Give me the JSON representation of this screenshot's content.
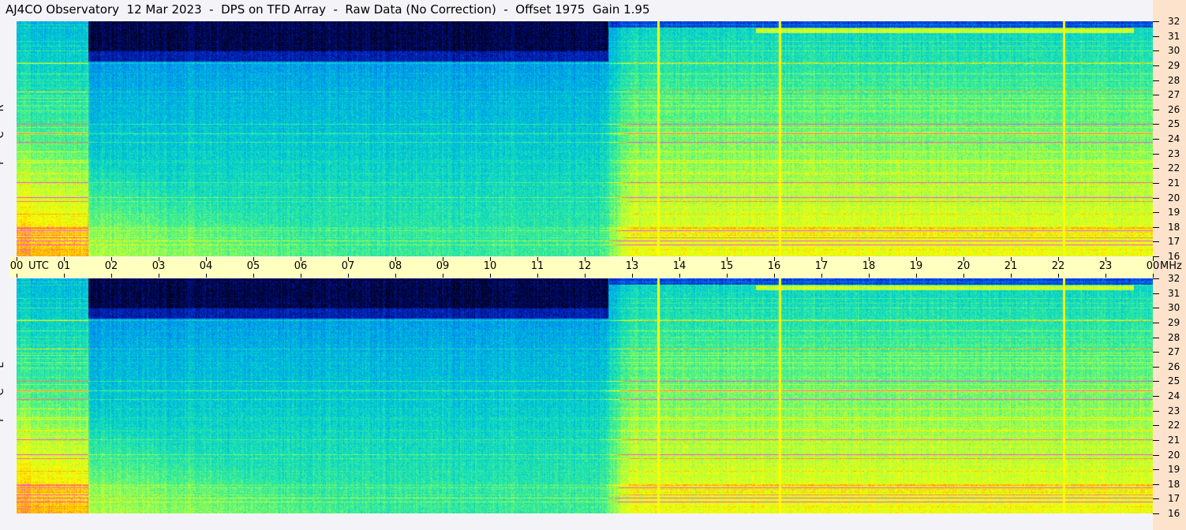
{
  "title": "AJ4CO Observatory  12 Mar 2023  -  DPS on TFD Array  -  Raw Data (No Correction)  -  Offset 1975  Gain 1.95",
  "chart_data": [
    {
      "type": "heatmap",
      "panel": "top",
      "ylabel": "R C P",
      "xlabel": "UTC",
      "yunit": "MHz",
      "xlim_hours_utc": [
        0,
        24
      ],
      "ylim_mhz": [
        16,
        32
      ],
      "x_ticks": [
        "00",
        "01",
        "02",
        "03",
        "04",
        "05",
        "06",
        "07",
        "08",
        "09",
        "10",
        "11",
        "12",
        "13",
        "14",
        "15",
        "16",
        "17",
        "18",
        "19",
        "20",
        "21",
        "22",
        "23",
        "00"
      ],
      "y_ticks": [
        "16",
        "17",
        "18",
        "19",
        "20",
        "21",
        "22",
        "23",
        "24",
        "25",
        "26",
        "27",
        "28",
        "29",
        "30",
        "31",
        "32"
      ],
      "colormap": [
        "#000010",
        "#001090",
        "#0040e0",
        "#0090f0",
        "#00d0d0",
        "#40f090",
        "#b0ff40",
        "#ffff00",
        "#ffa000",
        "#ff40ff"
      ]
    },
    {
      "type": "heatmap",
      "panel": "bottom",
      "ylabel": "L C P",
      "xlabel": "UTC",
      "yunit": "MHz",
      "xlim_hours_utc": [
        0,
        24
      ],
      "ylim_mhz": [
        16,
        32
      ],
      "x_ticks": [
        "00",
        "01",
        "02",
        "03",
        "04",
        "05",
        "06",
        "07",
        "08",
        "09",
        "10",
        "11",
        "12",
        "13",
        "14",
        "15",
        "16",
        "17",
        "18",
        "19",
        "20",
        "21",
        "22",
        "23",
        "00"
      ],
      "y_ticks": [
        "16",
        "17",
        "18",
        "19",
        "20",
        "21",
        "22",
        "23",
        "24",
        "25",
        "26",
        "27",
        "28",
        "29",
        "30",
        "31",
        "32"
      ],
      "colormap": [
        "#000010",
        "#001090",
        "#0040e0",
        "#0090f0",
        "#00d0d0",
        "#40f090",
        "#b0ff40",
        "#ffff00",
        "#ffa000",
        "#ff40ff"
      ]
    }
  ],
  "axis": {
    "utc_label": "UTC",
    "mhz_label": "MHz"
  },
  "markers": {
    "vertical_lines_utc": [
      13.55,
      16.12,
      22.12
    ]
  },
  "colors": {
    "timebar": "#ffffc0",
    "right_axis": "#fde3cc",
    "marker_line": "#c8e040"
  }
}
